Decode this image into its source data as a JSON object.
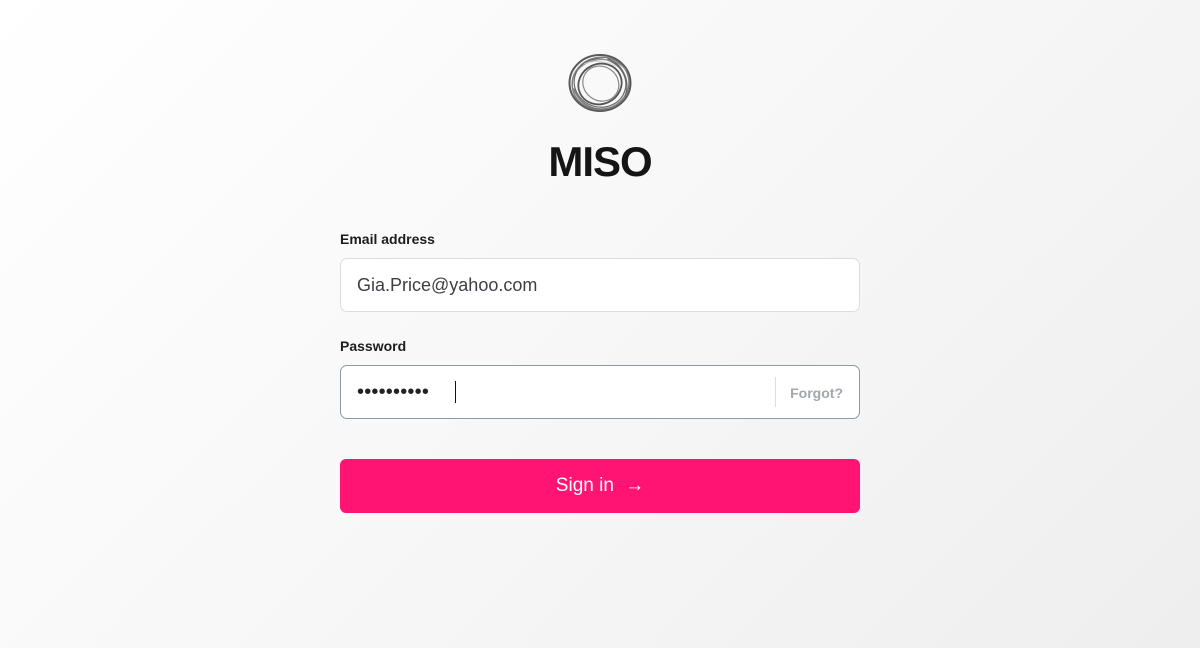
{
  "brand": {
    "name": "MISO",
    "logo_icon": "spiral-ring-logo"
  },
  "form": {
    "email": {
      "label": "Email address",
      "value": "Gia.Price@yahoo.com"
    },
    "password": {
      "label": "Password",
      "masked_value": "••••••••••",
      "forgot_label": "Forgot?"
    },
    "submit": {
      "label": "Sign in",
      "icon": "→",
      "icon_name": "arrow-right-icon"
    }
  },
  "colors": {
    "accent": "#ff1474",
    "text": "#151515",
    "muted": "#a2a7ad"
  }
}
